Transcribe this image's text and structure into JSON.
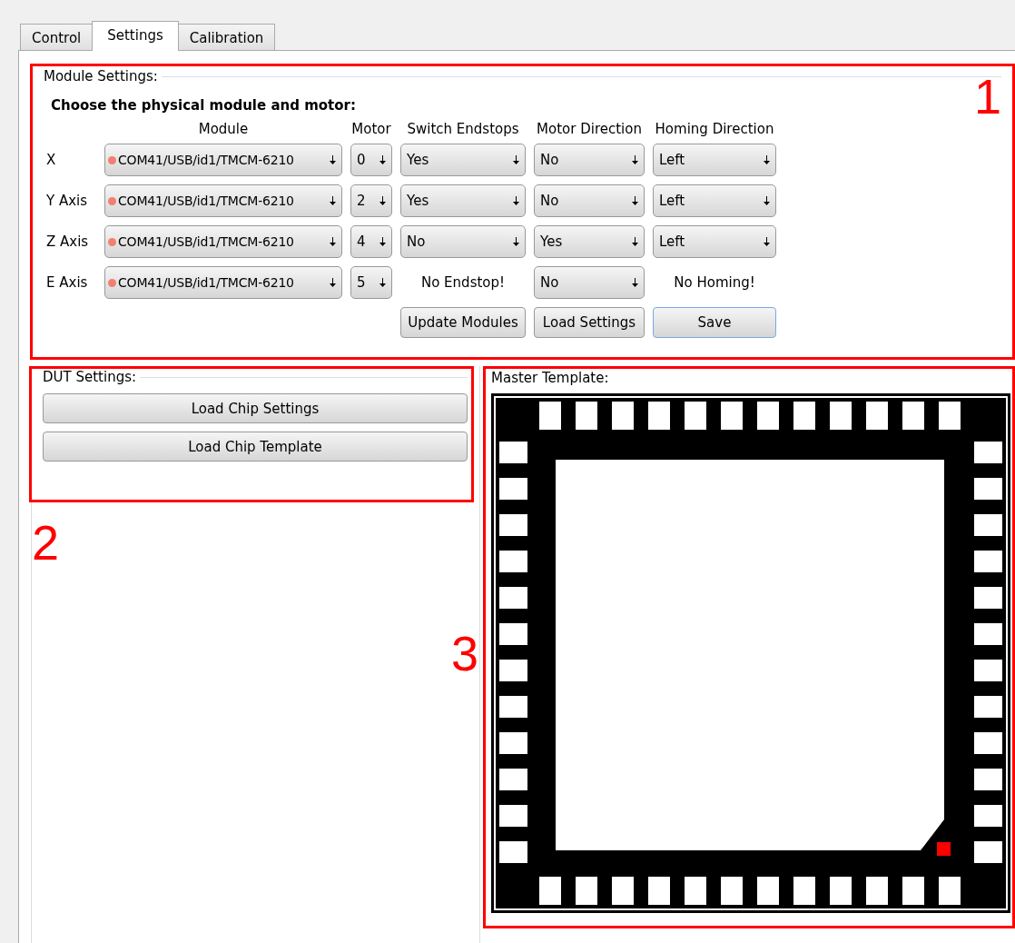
{
  "tabs": [
    {
      "label": "Control",
      "selected": false
    },
    {
      "label": "Settings",
      "selected": true
    },
    {
      "label": "Calibration",
      "selected": false
    }
  ],
  "module_settings": {
    "title": "Module Settings:",
    "annotation": "1",
    "heading": "Choose the physical module and motor:",
    "columns": [
      "Module",
      "Motor",
      "Switch Endstops",
      "Motor Direction",
      "Homing Direction"
    ],
    "rows": [
      {
        "label": "X",
        "module": "COM41/USB/id1/TMCM-6210",
        "motor": "0",
        "endstops": {
          "kind": "dropdown",
          "value": "Yes"
        },
        "direction": {
          "kind": "dropdown",
          "value": "No"
        },
        "homing": {
          "kind": "dropdown",
          "value": "Left"
        }
      },
      {
        "label": "Y Axis",
        "module": "COM41/USB/id1/TMCM-6210",
        "motor": "2",
        "endstops": {
          "kind": "dropdown",
          "value": "Yes"
        },
        "direction": {
          "kind": "dropdown",
          "value": "No"
        },
        "homing": {
          "kind": "dropdown",
          "value": "Left"
        }
      },
      {
        "label": "Z Axis",
        "module": "COM41/USB/id1/TMCM-6210",
        "motor": "4",
        "endstops": {
          "kind": "dropdown",
          "value": "No"
        },
        "direction": {
          "kind": "dropdown",
          "value": "Yes"
        },
        "homing": {
          "kind": "dropdown",
          "value": "Left"
        }
      },
      {
        "label": "E Axis",
        "module": "COM41/USB/id1/TMCM-6210",
        "motor": "5",
        "endstops": {
          "kind": "note",
          "value": "No Endstop!"
        },
        "direction": {
          "kind": "dropdown",
          "value": "No"
        },
        "homing": {
          "kind": "note",
          "value": "No Homing!"
        }
      }
    ],
    "buttons": [
      {
        "label": "Update Modules",
        "focused": false
      },
      {
        "label": "Load Settings",
        "focused": false
      },
      {
        "label": "Save",
        "focused": true
      }
    ]
  },
  "dut_settings": {
    "title": "DUT Settings:",
    "annotation": "2",
    "buttons": [
      {
        "label": "Load Chip Settings"
      },
      {
        "label": "Load Chip Template"
      }
    ]
  },
  "master_template": {
    "title": "Master Template:",
    "annotation": "3",
    "kind": "chip-template"
  }
}
